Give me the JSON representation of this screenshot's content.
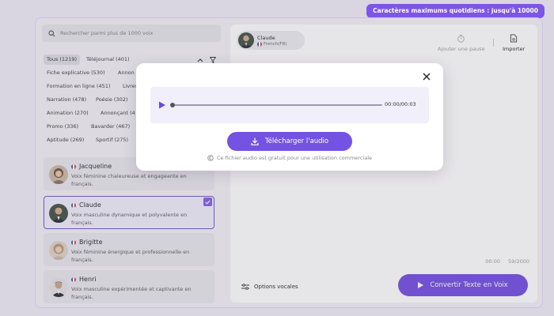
{
  "quota_badge": "Caractères maximums quotidiens : jusqu'à 10000",
  "search": {
    "placeholder": "Rechercher parmi plus de 1000 voix"
  },
  "categories": [
    "Tous (1219)",
    "Téléjournal (401)",
    "Fiche explicative (530)",
    "Annon",
    "Formation en ligne (451)",
    "Livres",
    "Narration (478)",
    "Poésie (302)",
    "Animation (270)",
    "Annonçant (4",
    "Promo (336)",
    "Bavarder (467)",
    "Aptitude (269)",
    "Sportif (275)"
  ],
  "voices": [
    {
      "name": "Jacqueline",
      "desc": "Voix féminine chaleureuse et engageante en français."
    },
    {
      "name": "Claude",
      "desc": "Voix masculine dynamique et polyvalente en français."
    },
    {
      "name": "Brigitte",
      "desc": "Voix féminine énergique et professionnelle en français."
    },
    {
      "name": "Henri",
      "desc": "Voix masculine expérimentée et captivante en français."
    }
  ],
  "selected_voice": {
    "name": "Claude",
    "lang": "French(FR)"
  },
  "toolbar": {
    "pause_label": "Ajouter une pause",
    "import_label": "Importer"
  },
  "editor": {
    "elapsed": "00:00",
    "char_count": "59/2000"
  },
  "bottom": {
    "options_label": "Options vocales",
    "convert_label": "Convertir Texte en Voix"
  },
  "modal": {
    "time": "00:00/00:03",
    "progress": 0,
    "download_label": "Télécharger l'audio",
    "license_note": "Ce fichier audio est gratuit pour une utilisation commerciale"
  },
  "colors": {
    "accent": "#6d47e0",
    "badge": "#7d56e6",
    "selected_border": "#6b4bd6"
  },
  "icons": [
    "search-icon",
    "chevron-up-icon",
    "filter-icon",
    "check-icon",
    "timer-icon",
    "document-icon",
    "sliders-icon",
    "play-icon",
    "close-icon",
    "download-icon",
    "copyright-icon"
  ]
}
